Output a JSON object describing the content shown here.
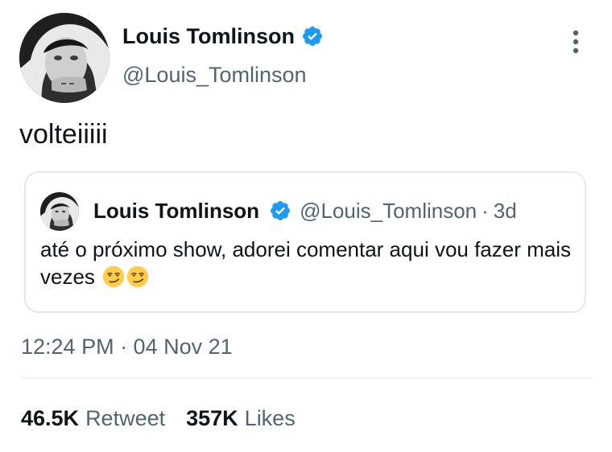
{
  "author": {
    "display_name": "Louis Tomlinson",
    "handle": "@Louis_Tomlinson"
  },
  "tweet": {
    "text": "volteiiiii",
    "timestamp": "12:24 PM · 04 Nov 21"
  },
  "quoted_tweet": {
    "display_name": "Louis Tomlinson",
    "handle": "@Louis_Tomlinson",
    "separator": "·",
    "age": "3d",
    "text": "até o próximo show, adorei comentar aqui vou fazer mais vezes"
  },
  "stats": {
    "retweets_count": "46.5K",
    "retweets_label": "Retweet",
    "likes_count": "357K",
    "likes_label": "Likes"
  },
  "colors": {
    "verified": "#1d9bf0",
    "secondary_text": "#536471",
    "primary_text": "#0f1419",
    "border": "#e3e8ec"
  },
  "icons": {
    "verified": "verified-badge-icon",
    "more": "more-vertical-icon",
    "emoji": "smirking-face-emoji"
  }
}
